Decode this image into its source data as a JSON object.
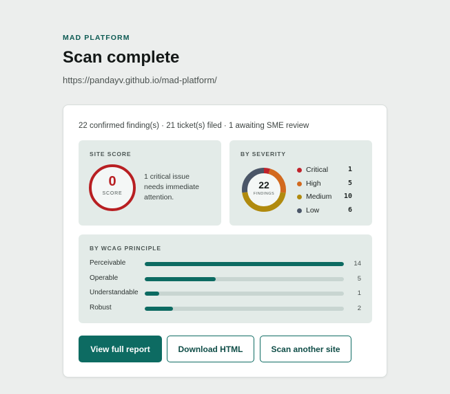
{
  "header": {
    "eyebrow": "MAD PLATFORM",
    "title": "Scan complete",
    "url": "https://pandayv.github.io/mad-platform/"
  },
  "summary": "22 confirmed finding(s) · 21 ticket(s) filed · 1 awaiting SME review",
  "site_score": {
    "label": "SITE SCORE",
    "value": "0",
    "caption": "SCORE",
    "message": "1 critical issue needs immediate attention.",
    "color": "#b81f22"
  },
  "severity": {
    "label": "BY SEVERITY",
    "total": "22",
    "total_caption": "FINDINGS",
    "items": [
      {
        "name": "Critical",
        "count": 1,
        "color": "#c0232b"
      },
      {
        "name": "High",
        "count": 5,
        "color": "#d2691e"
      },
      {
        "name": "Medium",
        "count": 10,
        "color": "#b08a0e"
      },
      {
        "name": "Low",
        "count": 6,
        "color": "#4b5668"
      }
    ]
  },
  "wcag": {
    "label": "BY WCAG PRINCIPLE",
    "max": 14,
    "items": [
      {
        "name": "Perceivable",
        "count": 14
      },
      {
        "name": "Operable",
        "count": 5
      },
      {
        "name": "Understandable",
        "count": 1
      },
      {
        "name": "Robust",
        "count": 2
      }
    ]
  },
  "actions": {
    "view_report": "View full report",
    "download_html": "Download HTML",
    "scan_another": "Scan another site"
  },
  "colors": {
    "accent": "#0d6b62",
    "panel_bg": "#e3ebe8"
  }
}
